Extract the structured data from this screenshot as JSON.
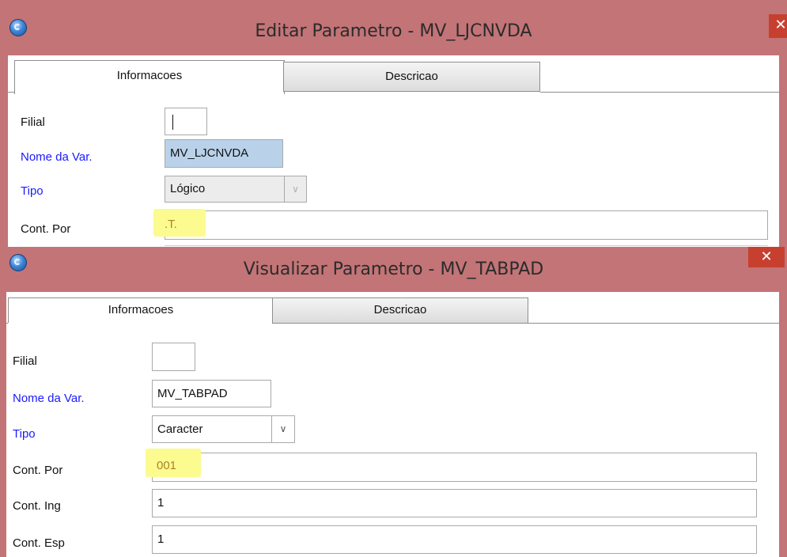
{
  "windows": [
    {
      "title": "Editar Parametro - MV_LJCNVDA",
      "close_glyph": "✕",
      "tabs": [
        {
          "label": "Informacoes",
          "active": true
        },
        {
          "label": "Descricao",
          "active": false
        }
      ],
      "fields": {
        "filial": {
          "label": "Filial",
          "value": ""
        },
        "nome_var": {
          "label": "Nome da Var.",
          "value": "MV_LJCNVDA"
        },
        "tipo": {
          "label": "Tipo",
          "value": "Lógico"
        },
        "cont_por": {
          "label": "Cont. Por",
          "value": ".T."
        }
      }
    },
    {
      "title": "Visualizar Parametro - MV_TABPAD",
      "close_glyph": "✕",
      "tabs": [
        {
          "label": "Informacoes",
          "active": true
        },
        {
          "label": "Descricao",
          "active": false
        }
      ],
      "fields": {
        "filial": {
          "label": "Filial",
          "value": ""
        },
        "nome_var": {
          "label": "Nome da Var.",
          "value": "MV_TABPAD"
        },
        "tipo": {
          "label": "Tipo",
          "value": "Caracter"
        },
        "cont_por": {
          "label": "Cont. Por",
          "value": "001"
        },
        "cont_ing": {
          "label": "Cont. Ing",
          "value": "1"
        },
        "cont_esp": {
          "label": "Cont. Esp",
          "value": "1"
        }
      }
    }
  ],
  "dropdown_glyph": "∨",
  "colors": {
    "title_bar": "#c37477",
    "close_button": "#c7402f",
    "highlight": "#fbfb8f",
    "blue_label": "#1a1aff"
  }
}
